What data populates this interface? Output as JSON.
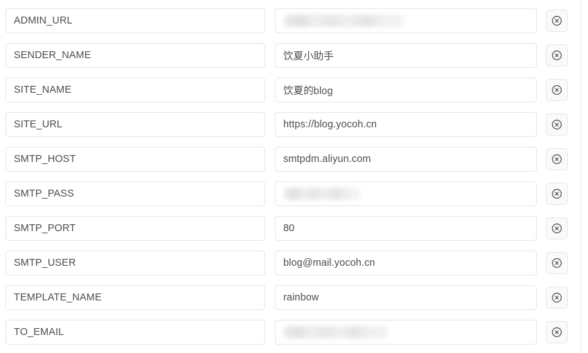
{
  "panel": {
    "name": "config-settings-list",
    "delete_icon": "circle-x-icon",
    "delete_button_title": "Delete"
  },
  "settings": [
    {
      "key": "ADMIN_URL",
      "value": "",
      "redacted": true,
      "redaction_width": "long"
    },
    {
      "key": "SENDER_NAME",
      "value": "饮夏小助手",
      "redacted": false,
      "redaction_width": ""
    },
    {
      "key": "SITE_NAME",
      "value": "饮夏的blog",
      "redacted": false,
      "redaction_width": ""
    },
    {
      "key": "SITE_URL",
      "value": "https://blog.yocoh.cn",
      "redacted": false,
      "redaction_width": ""
    },
    {
      "key": "SMTP_HOST",
      "value": "smtpdm.aliyun.com",
      "redacted": false,
      "redaction_width": ""
    },
    {
      "key": "SMTP_PASS",
      "value": "",
      "redacted": true,
      "redaction_width": "short"
    },
    {
      "key": "SMTP_PORT",
      "value": "80",
      "redacted": false,
      "redaction_width": ""
    },
    {
      "key": "SMTP_USER",
      "value": "blog@mail.yocoh.cn",
      "redacted": false,
      "redaction_width": ""
    },
    {
      "key": "TEMPLATE_NAME",
      "value": "rainbow",
      "redacted": false,
      "redaction_width": ""
    },
    {
      "key": "TO_EMAIL",
      "value": "",
      "redacted": true,
      "redaction_width": "mid"
    }
  ],
  "colors": {
    "field_border": "#e4e6e8",
    "text": "#4d4d4d",
    "button_bg": "#fafafa",
    "panel_divider": "#e8e8e8"
  }
}
